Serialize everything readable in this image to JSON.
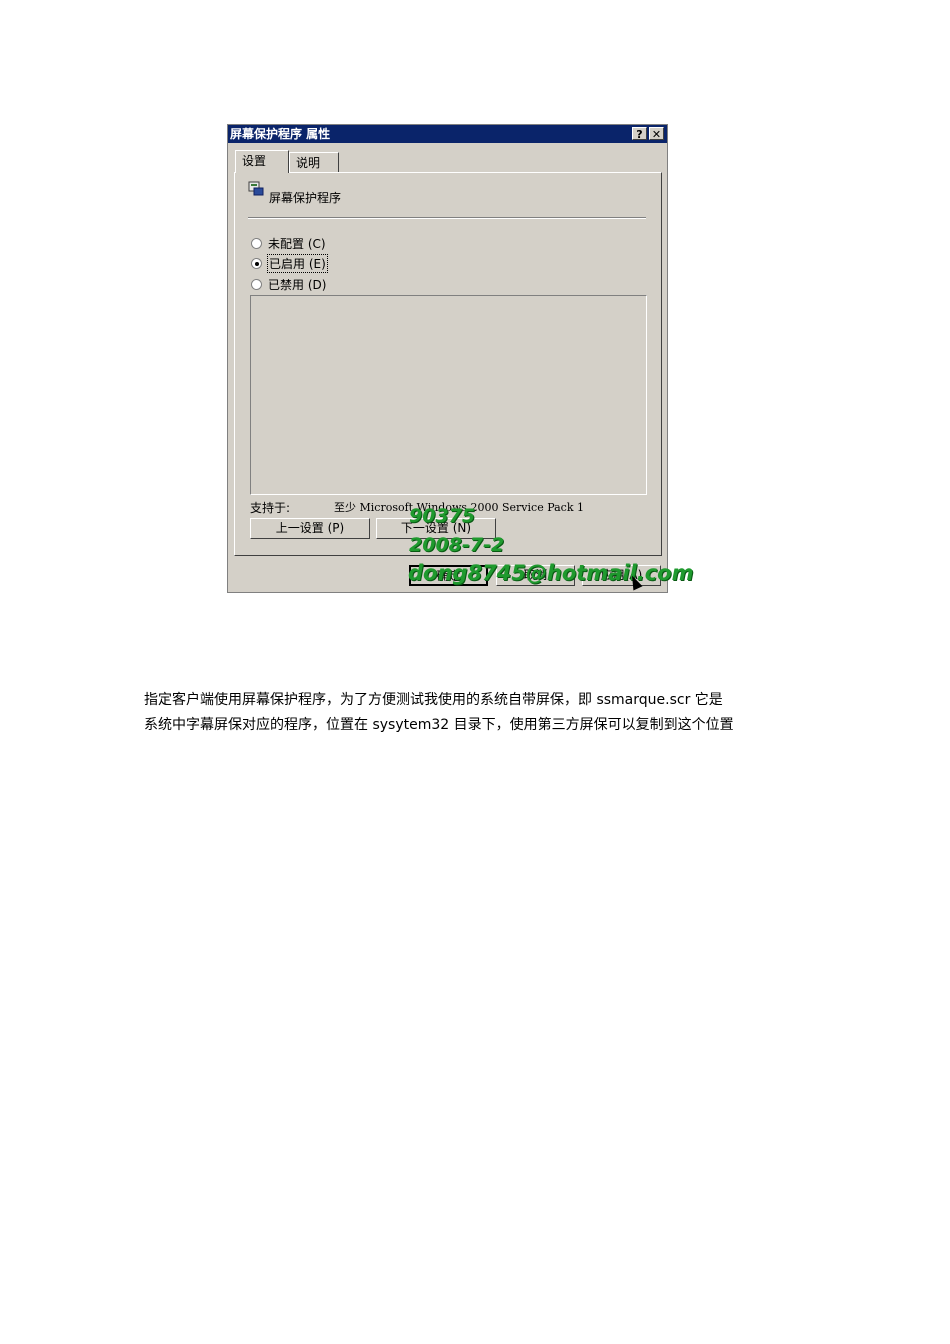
{
  "dialog": {
    "title": "屏幕保护程序 属性",
    "help_button": "?",
    "close_button": "✕",
    "tabs": [
      {
        "label": "设置"
      },
      {
        "label": "说明"
      }
    ],
    "policy_name": "屏幕保护程序",
    "options": [
      {
        "label": "未配置 (C)"
      },
      {
        "label": "已启用 (E)"
      },
      {
        "label": "已禁用 (D)"
      }
    ],
    "selected_option": "已启用 (E)",
    "supported_label": "支持于:",
    "supported_value": "至少 Microsoft Windows 2000 Service Pack 1",
    "prev_button": "上一设置 (P)",
    "next_button": "下一设置 (N)",
    "ok_button": "确定",
    "cancel_button": "取消",
    "apply_button": "应用(A)"
  },
  "watermark": {
    "line1": "90375",
    "line2": "2008-7-2",
    "line3": "dong8745@hotmail.com",
    "color": "#1f9a2e"
  },
  "paragraph": {
    "line1": "指定客户端使用屏幕保护程序，为了方便测试我使用的系统自带屏保，即 ssmarque.scr 它是",
    "line2": "系统中字幕屏保对应的程序，位置在 sysytem32 目录下，使用第三方屏保可以复制到这个位置"
  },
  "colors": {
    "titlebar": "#0a246a",
    "dialog_face": "#d4d0c8"
  },
  "icons": [
    "policy-icon",
    "help-icon",
    "close-icon",
    "mouse-cursor-icon"
  ]
}
